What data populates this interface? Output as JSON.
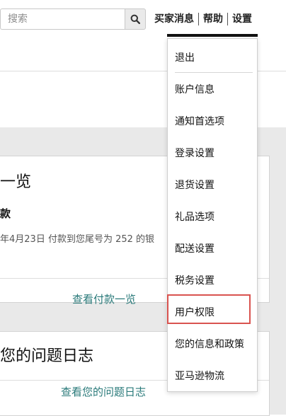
{
  "search": {
    "placeholder": "搜索"
  },
  "top_nav": {
    "buyer_messages": "买家消息",
    "help": "帮助",
    "settings": "设置"
  },
  "cards": {
    "payments": {
      "title": "一览",
      "subtitle": "款",
      "description": "年4月23日 付款到您尾号为 252 的银",
      "link": "查看付款一览"
    },
    "issues": {
      "title": "您的问题日志",
      "link": "查看您的问题日志"
    }
  },
  "settings_menu": {
    "items": [
      {
        "label": "退出"
      },
      {
        "label": "账户信息"
      },
      {
        "label": "通知首选项"
      },
      {
        "label": "登录设置"
      },
      {
        "label": "退货设置"
      },
      {
        "label": "礼品选项"
      },
      {
        "label": "配送设置"
      },
      {
        "label": "税务设置"
      },
      {
        "label": "用户权限"
      },
      {
        "label": "您的信息和政策"
      },
      {
        "label": "亚马逊物流"
      }
    ],
    "highlighted_item": "用户权限",
    "highlight_color": "#d9534f"
  },
  "colors": {
    "link": "#2a7a7a",
    "content_bg": "#e9e9e9"
  },
  "icons": {
    "search_button": "search-icon"
  }
}
